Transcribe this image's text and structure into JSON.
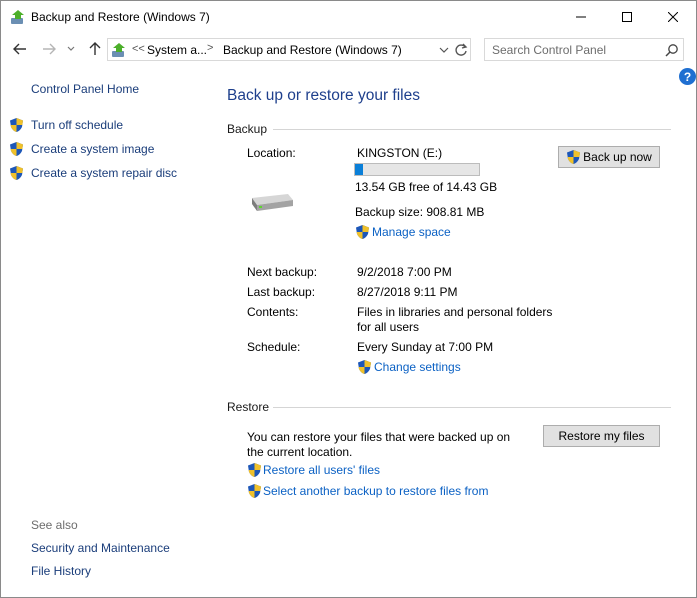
{
  "window": {
    "title": "Backup and Restore (Windows 7)"
  },
  "address": {
    "chevron": "<<",
    "segment1": "System a...",
    "separator": ">",
    "segment2": "Backup and Restore (Windows 7)"
  },
  "search": {
    "placeholder": "Search Control Panel"
  },
  "help_label": "?",
  "sidebar": {
    "home": "Control Panel Home",
    "items": [
      "Turn off schedule",
      "Create a system image",
      "Create a system repair disc"
    ],
    "see_also_title": "See also",
    "see_also": [
      "Security and Maintenance",
      "File History"
    ]
  },
  "main": {
    "heading": "Back up or restore your files",
    "backup": {
      "section_title": "Backup",
      "location_label": "Location:",
      "location_value": "KINGSTON (E:)",
      "usage_fraction": 0.062,
      "free_text": "13.54 GB free of 14.43 GB",
      "backup_size": "Backup size: 908.81 MB",
      "manage_space": "Manage space",
      "backup_now": "Back up now",
      "next_label": "Next backup:",
      "next_value": "9/2/2018 7:00 PM",
      "last_label": "Last backup:",
      "last_value": "8/27/2018 9:11 PM",
      "contents_label": "Contents:",
      "contents_line1": "Files in libraries and personal folders",
      "contents_line2": "for all users",
      "schedule_label": "Schedule:",
      "schedule_value": "Every Sunday at 7:00 PM",
      "change_settings": "Change settings"
    },
    "restore": {
      "section_title": "Restore",
      "desc_line1": "You can restore your files that were backed up on",
      "desc_line2": "the current location.",
      "restore_button": "Restore my files",
      "restore_all": "Restore all users' files",
      "select_another": "Select another backup to restore files from"
    }
  },
  "colors": {
    "link": "#0b61c4",
    "heading": "#1e3f8c",
    "progress": "#0a7fd8"
  }
}
